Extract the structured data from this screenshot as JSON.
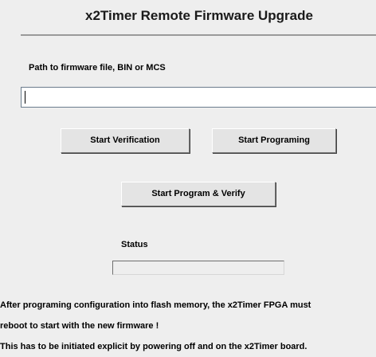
{
  "window": {
    "title": "x2Timer Remote Firmware Upgrade"
  },
  "path": {
    "label": "Path to firmware file,  BIN or MCS",
    "value": "",
    "placeholder": ""
  },
  "buttons": {
    "start_verification": "Start  Verification",
    "start_programing": "Start  Programing",
    "start_program_verify": "Start  Program & Verify"
  },
  "status": {
    "label": "Status",
    "value": ""
  },
  "notes": [
    "After programing configuration into flash memory, the x2Timer FPGA must",
    "reboot to start with the new firmware !",
    "This has to be initiated explicit by powering off and on the x2Timer board."
  ],
  "colors": {
    "background": "#eeeeee",
    "button_face": "#e4e4e4",
    "input_border": "#6b7c8d",
    "rule": "#9a9a9a"
  }
}
